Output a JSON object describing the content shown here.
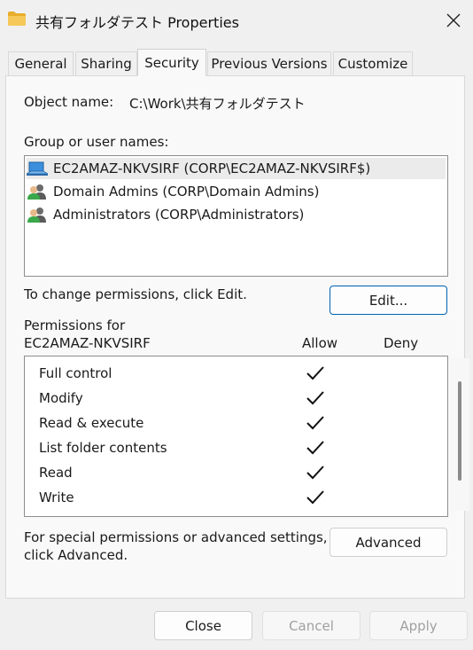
{
  "window": {
    "title": "共有フォルダテスト Properties"
  },
  "tabs": [
    {
      "label": "General"
    },
    {
      "label": "Sharing"
    },
    {
      "label": "Security"
    },
    {
      "label": "Previous Versions"
    },
    {
      "label": "Customize"
    }
  ],
  "active_tab": "Security",
  "security": {
    "object_name_label": "Object name:",
    "object_name_value": "C:\\Work\\共有フォルダテスト",
    "group_label": "Group or user names:",
    "users": [
      {
        "name": "EC2AMAZ-NKVSIRF (CORP\\EC2AMAZ-NKVSIRF$)",
        "icon": "computer-icon",
        "selected": true
      },
      {
        "name": "Domain Admins (CORP\\Domain Admins)",
        "icon": "users-group-icon",
        "selected": false
      },
      {
        "name": "Administrators (CORP\\Administrators)",
        "icon": "users-group-icon",
        "selected": false
      }
    ],
    "change_text": "To change permissions, click Edit.",
    "edit_button": "Edit...",
    "permissions_for_label": "Permissions for",
    "permissions_for_name": "EC2AMAZ-NKVSIRF",
    "allow_header": "Allow",
    "deny_header": "Deny",
    "permissions": [
      {
        "name": "Full control",
        "allow": true,
        "deny": false
      },
      {
        "name": "Modify",
        "allow": true,
        "deny": false
      },
      {
        "name": "Read & execute",
        "allow": true,
        "deny": false
      },
      {
        "name": "List folder contents",
        "allow": true,
        "deny": false
      },
      {
        "name": "Read",
        "allow": true,
        "deny": false
      },
      {
        "name": "Write",
        "allow": true,
        "deny": false
      }
    ],
    "special_text_line1": "For special permissions or advanced settings,",
    "special_text_line2": "click Advanced.",
    "advanced_button": "Advanced"
  },
  "footer": {
    "close": "Close",
    "cancel": "Cancel",
    "apply": "Apply"
  },
  "colors": {
    "accent": "#0063b1",
    "window_bg": "#f0f0f0",
    "panel_bg": "#f9f9f9",
    "folder": "#f2c14e"
  }
}
